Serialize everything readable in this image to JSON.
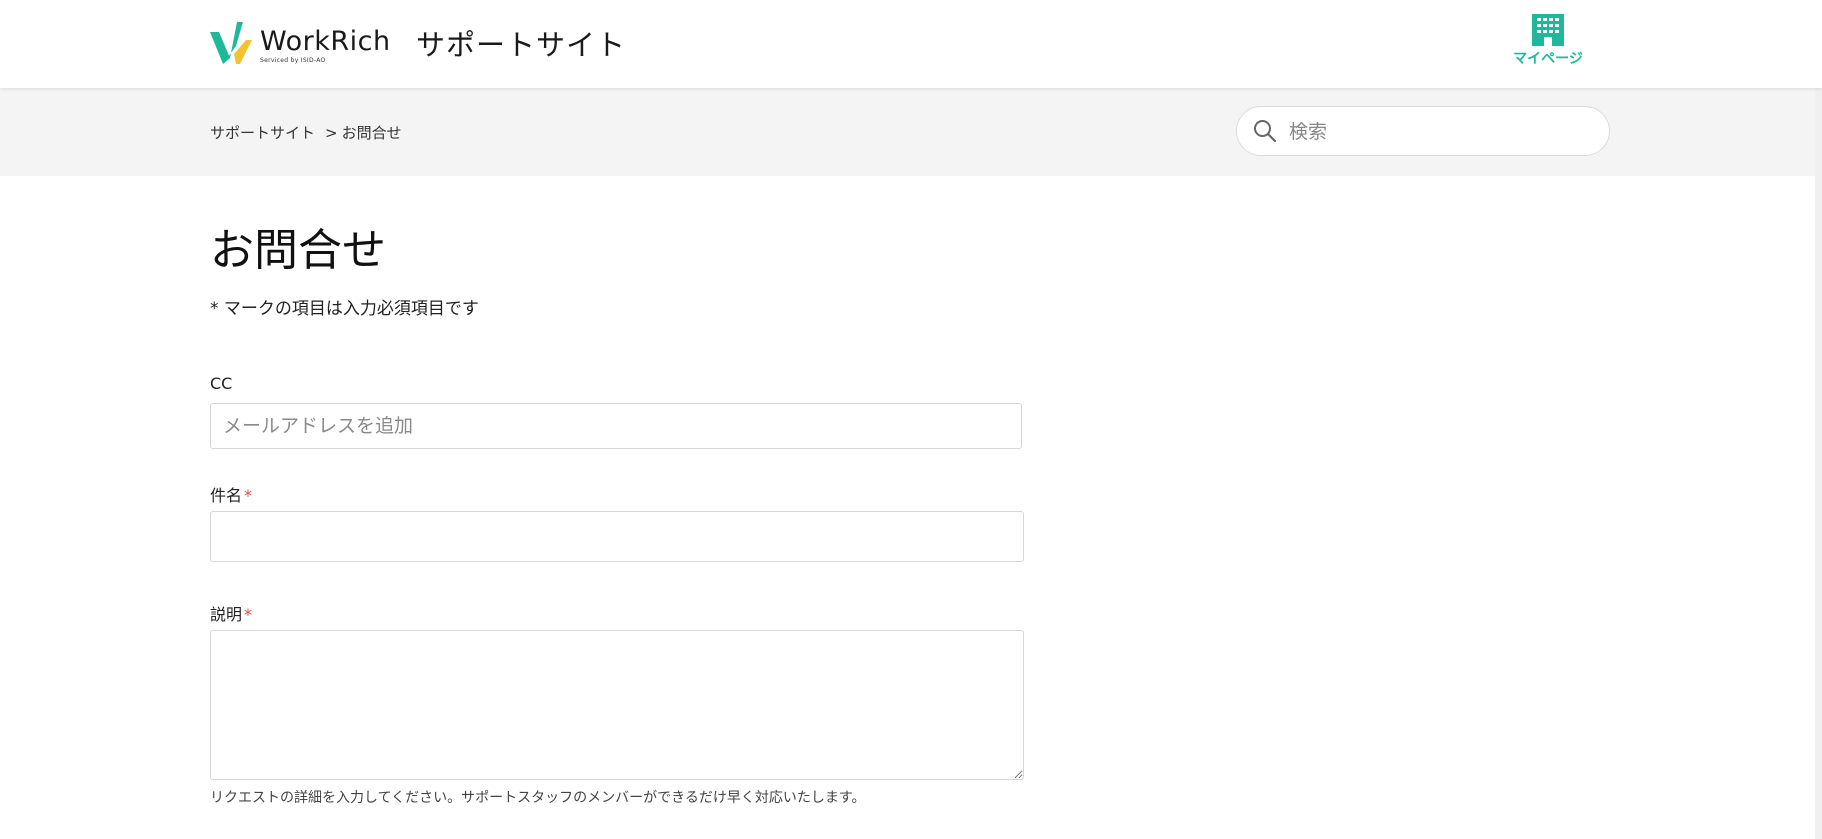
{
  "header": {
    "logo_word": "WorkRich",
    "logo_sub": "Serviced by ISID-AO",
    "site_title": "サポートサイト",
    "mypage_label": "マイページ",
    "mypage_icon": "building-icon",
    "accent_color": "#1fb89a"
  },
  "breadcrumb": {
    "items": [
      "サポートサイト",
      "お問合せ"
    ],
    "separator": ">"
  },
  "search": {
    "placeholder": "検索",
    "icon": "search-icon"
  },
  "form": {
    "title": "お問合せ",
    "required_note": "* マークの項目は入力必須項目です",
    "cc": {
      "label": "CC",
      "placeholder": "メールアドレスを追加",
      "value": ""
    },
    "subject": {
      "label": "件名",
      "required_mark": "*",
      "value": ""
    },
    "description": {
      "label": "説明",
      "required_mark": "*",
      "value": "",
      "helper": "リクエストの詳細を入力してください。サポートスタッフのメンバーができるだけ早く対応いたします。"
    }
  }
}
